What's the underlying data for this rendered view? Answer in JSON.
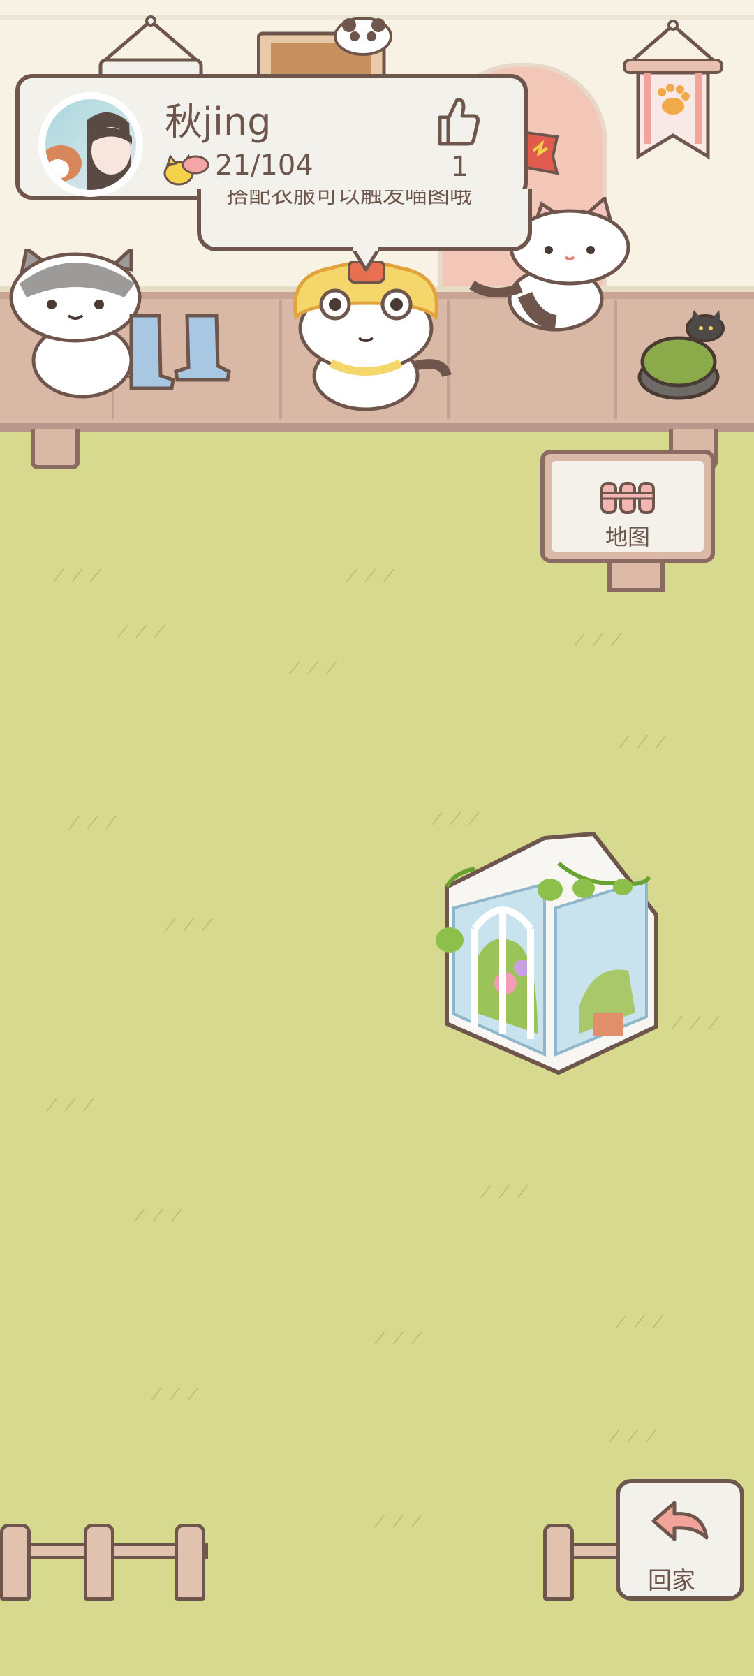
{
  "profile": {
    "name": "秋jing",
    "fish_count": "21/104",
    "likes": "1"
  },
  "bubble": {
    "text": "搭配衣服可以触发喵图哦"
  },
  "map_sign": {
    "label": "地图"
  },
  "home_button": {
    "label": "回家"
  },
  "colors": {
    "grass": "#d6d98e",
    "outline": "#6e564d",
    "card_bg": "#f3f1ec",
    "deck": "#d9b8a6",
    "accent_pink": "#f2a49a"
  },
  "icons": {
    "like": "thumbs-up-icon",
    "fish": "cat-fish-icon",
    "map": "fence-map-icon",
    "home": "return-arrow-icon",
    "banner": "paw-banner-icon"
  }
}
